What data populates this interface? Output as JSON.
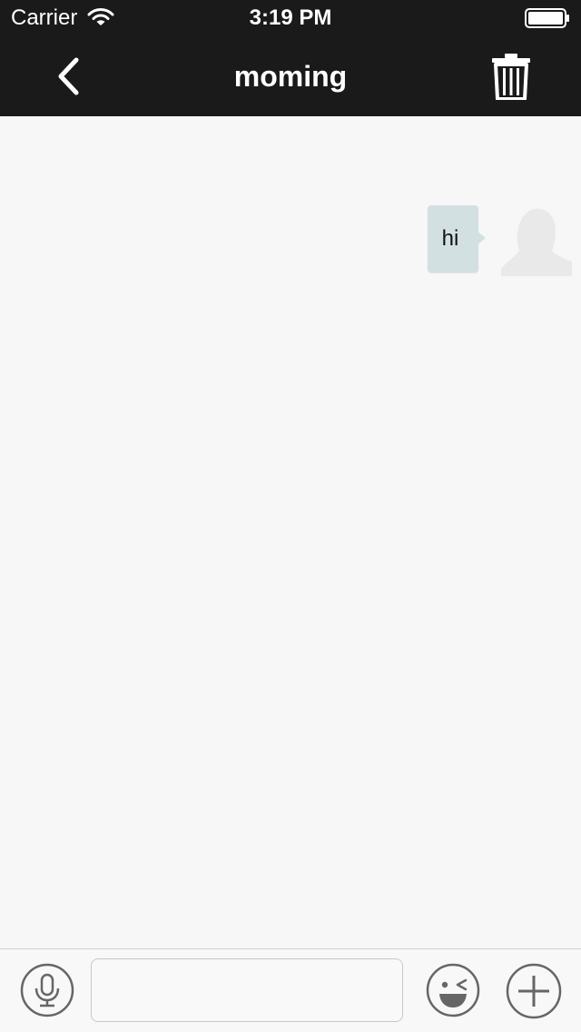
{
  "status_bar": {
    "carrier": "Carrier",
    "time": "3:19 PM",
    "wifi_icon": "wifi-icon",
    "battery_icon": "battery-icon"
  },
  "nav": {
    "title": "moming",
    "back_icon": "chevron-left-icon",
    "trash_icon": "trash-icon"
  },
  "messages": [
    {
      "text": "hi",
      "sender": "self",
      "avatar_icon": "avatar-placeholder-icon"
    }
  ],
  "input_bar": {
    "voice_icon": "microphone-icon",
    "message_value": "",
    "message_placeholder": "",
    "emoji_icon": "emoji-wink-icon",
    "more_icon": "plus-circle-icon"
  },
  "colors": {
    "nav_background": "#1a1a1a",
    "chat_background": "#f7f7f7",
    "bubble_background": "#d2e0e2",
    "icon_gray": "#666666",
    "avatar_placeholder": "#e9e9e9"
  }
}
